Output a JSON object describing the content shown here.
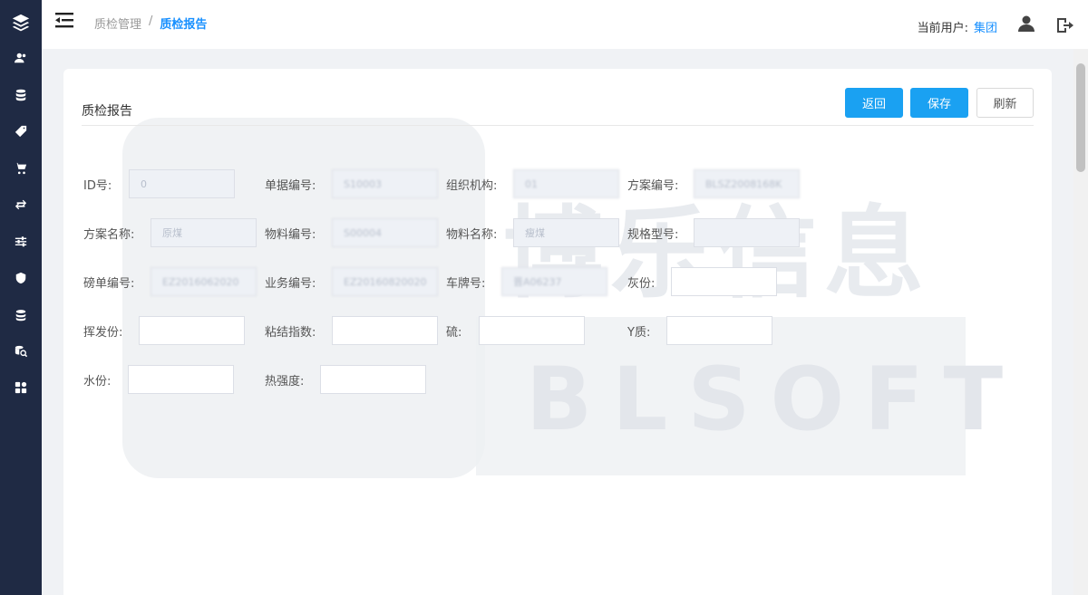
{
  "sidebar": {
    "icons": [
      "layers-icon",
      "users-icon",
      "database-icon",
      "tag-icon",
      "cart-icon",
      "exchange-icon",
      "sliders-icon",
      "shield-icon",
      "stack-icon",
      "search-db-icon",
      "dashboard-icon"
    ]
  },
  "header": {
    "breadcrumb": [
      "质检管理",
      "/",
      "质检报告"
    ],
    "current_user_label": "当前用户:",
    "current_user": "集团"
  },
  "card": {
    "title": "质检报告",
    "buttons": {
      "back": "返回",
      "save": "保存",
      "refresh": "刷新"
    }
  },
  "watermark": {
    "cn": "博乐信息",
    "en": "BLSOFT"
  },
  "form": {
    "id_label": "ID号:",
    "id_value": "0",
    "doc_no_label": "单据编号:",
    "doc_no_value": "S10003",
    "org_label": "组织机构:",
    "org_value": "01",
    "plan_no_label": "方案编号:",
    "plan_no_value": "BLSZ2008168K",
    "plan_name_label": "方案名称:",
    "plan_name_value": "原煤",
    "material_no_label": "物料编号:",
    "material_no_value": "S00004",
    "material_name_label": "物料名称:",
    "material_name_value": "瘦煤",
    "spec_label": "规格型号:",
    "spec_value": "",
    "weigh_no_label": "磅单编号:",
    "weigh_no_value": "EZ2016062020",
    "biz_no_label": "业务编号:",
    "biz_no_value": "EZ2016082002006",
    "plate_label": "车牌号:",
    "plate_value": "晋A06237",
    "ash_label": "灰份:",
    "ash_value": "",
    "volatile_label": "挥发份:",
    "volatile_value": "",
    "caking_label": "粘结指数:",
    "caking_value": "",
    "sulfur_label": "硫:",
    "sulfur_value": "",
    "y_label": "Y质:",
    "y_value": "",
    "water_label": "水份:",
    "water_value": "",
    "hot_label": "热强度:",
    "hot_value": ""
  },
  "colors": {
    "sidebar": "#1f2a44",
    "accent": "#1aa1f2",
    "link": "#1890ff"
  }
}
